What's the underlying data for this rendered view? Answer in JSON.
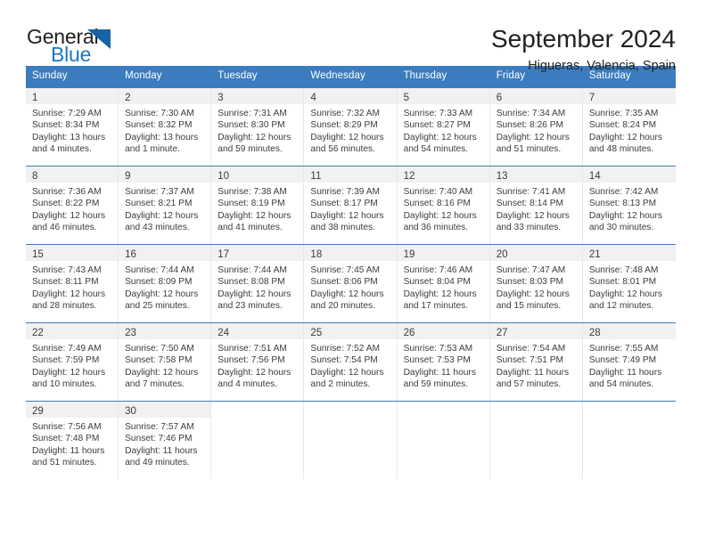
{
  "brand": {
    "name_top": "General",
    "name_bottom": "Blue",
    "accent_color": "#1f77c2",
    "triangle_color": "#1564a8"
  },
  "header": {
    "title": "September 2024",
    "subtitle": "Higueras, Valencia, Spain"
  },
  "theme": {
    "header_row_bg": "#3b7cbe",
    "daynum_band_bg": "#f1f1f1",
    "cell_border": "#e8e8e8",
    "text_color": "#3c3c3c"
  },
  "weekdays": [
    "Sunday",
    "Monday",
    "Tuesday",
    "Wednesday",
    "Thursday",
    "Friday",
    "Saturday"
  ],
  "weeks": [
    [
      {
        "day": "1",
        "sunrise": "Sunrise: 7:29 AM",
        "sunset": "Sunset: 8:34 PM",
        "daylight_1": "Daylight: 13 hours",
        "daylight_2": "and 4 minutes."
      },
      {
        "day": "2",
        "sunrise": "Sunrise: 7:30 AM",
        "sunset": "Sunset: 8:32 PM",
        "daylight_1": "Daylight: 13 hours",
        "daylight_2": "and 1 minute."
      },
      {
        "day": "3",
        "sunrise": "Sunrise: 7:31 AM",
        "sunset": "Sunset: 8:30 PM",
        "daylight_1": "Daylight: 12 hours",
        "daylight_2": "and 59 minutes."
      },
      {
        "day": "4",
        "sunrise": "Sunrise: 7:32 AM",
        "sunset": "Sunset: 8:29 PM",
        "daylight_1": "Daylight: 12 hours",
        "daylight_2": "and 56 minutes."
      },
      {
        "day": "5",
        "sunrise": "Sunrise: 7:33 AM",
        "sunset": "Sunset: 8:27 PM",
        "daylight_1": "Daylight: 12 hours",
        "daylight_2": "and 54 minutes."
      },
      {
        "day": "6",
        "sunrise": "Sunrise: 7:34 AM",
        "sunset": "Sunset: 8:26 PM",
        "daylight_1": "Daylight: 12 hours",
        "daylight_2": "and 51 minutes."
      },
      {
        "day": "7",
        "sunrise": "Sunrise: 7:35 AM",
        "sunset": "Sunset: 8:24 PM",
        "daylight_1": "Daylight: 12 hours",
        "daylight_2": "and 48 minutes."
      }
    ],
    [
      {
        "day": "8",
        "sunrise": "Sunrise: 7:36 AM",
        "sunset": "Sunset: 8:22 PM",
        "daylight_1": "Daylight: 12 hours",
        "daylight_2": "and 46 minutes."
      },
      {
        "day": "9",
        "sunrise": "Sunrise: 7:37 AM",
        "sunset": "Sunset: 8:21 PM",
        "daylight_1": "Daylight: 12 hours",
        "daylight_2": "and 43 minutes."
      },
      {
        "day": "10",
        "sunrise": "Sunrise: 7:38 AM",
        "sunset": "Sunset: 8:19 PM",
        "daylight_1": "Daylight: 12 hours",
        "daylight_2": "and 41 minutes."
      },
      {
        "day": "11",
        "sunrise": "Sunrise: 7:39 AM",
        "sunset": "Sunset: 8:17 PM",
        "daylight_1": "Daylight: 12 hours",
        "daylight_2": "and 38 minutes."
      },
      {
        "day": "12",
        "sunrise": "Sunrise: 7:40 AM",
        "sunset": "Sunset: 8:16 PM",
        "daylight_1": "Daylight: 12 hours",
        "daylight_2": "and 36 minutes."
      },
      {
        "day": "13",
        "sunrise": "Sunrise: 7:41 AM",
        "sunset": "Sunset: 8:14 PM",
        "daylight_1": "Daylight: 12 hours",
        "daylight_2": "and 33 minutes."
      },
      {
        "day": "14",
        "sunrise": "Sunrise: 7:42 AM",
        "sunset": "Sunset: 8:13 PM",
        "daylight_1": "Daylight: 12 hours",
        "daylight_2": "and 30 minutes."
      }
    ],
    [
      {
        "day": "15",
        "sunrise": "Sunrise: 7:43 AM",
        "sunset": "Sunset: 8:11 PM",
        "daylight_1": "Daylight: 12 hours",
        "daylight_2": "and 28 minutes."
      },
      {
        "day": "16",
        "sunrise": "Sunrise: 7:44 AM",
        "sunset": "Sunset: 8:09 PM",
        "daylight_1": "Daylight: 12 hours",
        "daylight_2": "and 25 minutes."
      },
      {
        "day": "17",
        "sunrise": "Sunrise: 7:44 AM",
        "sunset": "Sunset: 8:08 PM",
        "daylight_1": "Daylight: 12 hours",
        "daylight_2": "and 23 minutes."
      },
      {
        "day": "18",
        "sunrise": "Sunrise: 7:45 AM",
        "sunset": "Sunset: 8:06 PM",
        "daylight_1": "Daylight: 12 hours",
        "daylight_2": "and 20 minutes."
      },
      {
        "day": "19",
        "sunrise": "Sunrise: 7:46 AM",
        "sunset": "Sunset: 8:04 PM",
        "daylight_1": "Daylight: 12 hours",
        "daylight_2": "and 17 minutes."
      },
      {
        "day": "20",
        "sunrise": "Sunrise: 7:47 AM",
        "sunset": "Sunset: 8:03 PM",
        "daylight_1": "Daylight: 12 hours",
        "daylight_2": "and 15 minutes."
      },
      {
        "day": "21",
        "sunrise": "Sunrise: 7:48 AM",
        "sunset": "Sunset: 8:01 PM",
        "daylight_1": "Daylight: 12 hours",
        "daylight_2": "and 12 minutes."
      }
    ],
    [
      {
        "day": "22",
        "sunrise": "Sunrise: 7:49 AM",
        "sunset": "Sunset: 7:59 PM",
        "daylight_1": "Daylight: 12 hours",
        "daylight_2": "and 10 minutes."
      },
      {
        "day": "23",
        "sunrise": "Sunrise: 7:50 AM",
        "sunset": "Sunset: 7:58 PM",
        "daylight_1": "Daylight: 12 hours",
        "daylight_2": "and 7 minutes."
      },
      {
        "day": "24",
        "sunrise": "Sunrise: 7:51 AM",
        "sunset": "Sunset: 7:56 PM",
        "daylight_1": "Daylight: 12 hours",
        "daylight_2": "and 4 minutes."
      },
      {
        "day": "25",
        "sunrise": "Sunrise: 7:52 AM",
        "sunset": "Sunset: 7:54 PM",
        "daylight_1": "Daylight: 12 hours",
        "daylight_2": "and 2 minutes."
      },
      {
        "day": "26",
        "sunrise": "Sunrise: 7:53 AM",
        "sunset": "Sunset: 7:53 PM",
        "daylight_1": "Daylight: 11 hours",
        "daylight_2": "and 59 minutes."
      },
      {
        "day": "27",
        "sunrise": "Sunrise: 7:54 AM",
        "sunset": "Sunset: 7:51 PM",
        "daylight_1": "Daylight: 11 hours",
        "daylight_2": "and 57 minutes."
      },
      {
        "day": "28",
        "sunrise": "Sunrise: 7:55 AM",
        "sunset": "Sunset: 7:49 PM",
        "daylight_1": "Daylight: 11 hours",
        "daylight_2": "and 54 minutes."
      }
    ],
    [
      {
        "day": "29",
        "sunrise": "Sunrise: 7:56 AM",
        "sunset": "Sunset: 7:48 PM",
        "daylight_1": "Daylight: 11 hours",
        "daylight_2": "and 51 minutes."
      },
      {
        "day": "30",
        "sunrise": "Sunrise: 7:57 AM",
        "sunset": "Sunset: 7:46 PM",
        "daylight_1": "Daylight: 11 hours",
        "daylight_2": "and 49 minutes."
      },
      {
        "day": "",
        "sunrise": "",
        "sunset": "",
        "daylight_1": "",
        "daylight_2": ""
      },
      {
        "day": "",
        "sunrise": "",
        "sunset": "",
        "daylight_1": "",
        "daylight_2": ""
      },
      {
        "day": "",
        "sunrise": "",
        "sunset": "",
        "daylight_1": "",
        "daylight_2": ""
      },
      {
        "day": "",
        "sunrise": "",
        "sunset": "",
        "daylight_1": "",
        "daylight_2": ""
      },
      {
        "day": "",
        "sunrise": "",
        "sunset": "",
        "daylight_1": "",
        "daylight_2": ""
      }
    ]
  ]
}
